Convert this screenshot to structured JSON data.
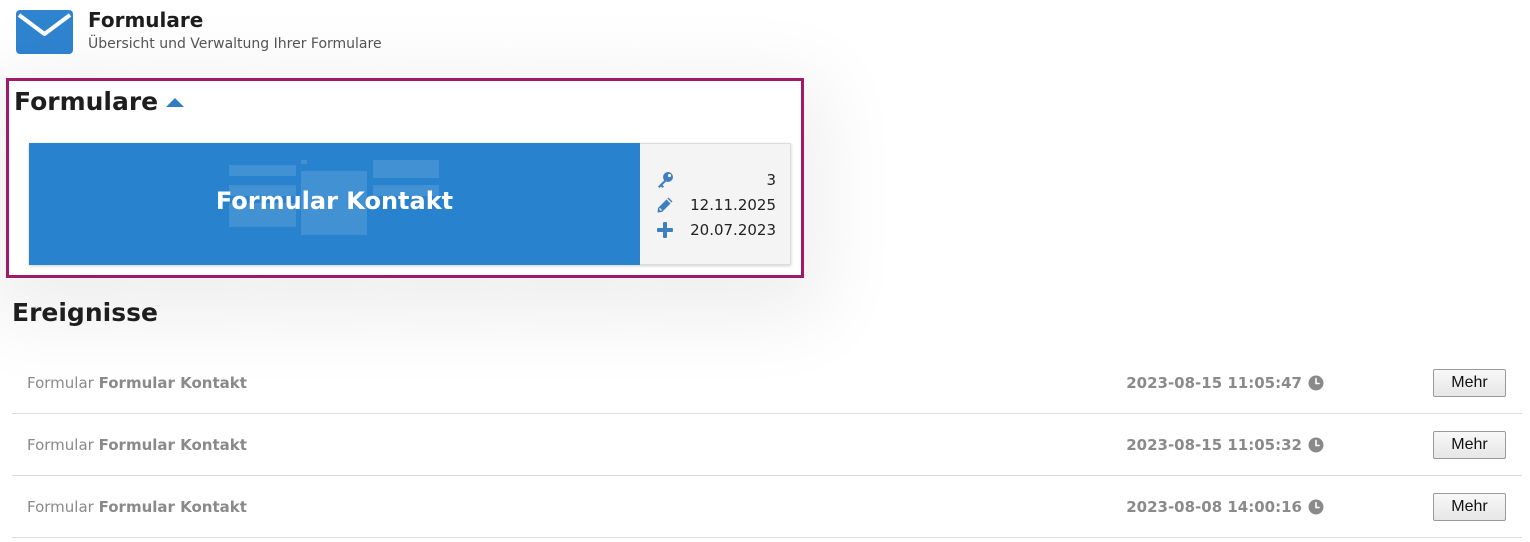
{
  "header": {
    "title": "Formulare",
    "subtitle": "Übersicht und Verwaltung Ihrer Formulare",
    "icon": "envelope-icon"
  },
  "forms_section": {
    "heading": "Formulare",
    "toggle_icon": "caret-up-icon",
    "highlight_color": "#a0196b",
    "cards": [
      {
        "title": "Formular Kontakt",
        "background_color": "#2882cd",
        "meta": [
          {
            "icon": "key-icon",
            "value": "3"
          },
          {
            "icon": "pencil-icon",
            "value": "12.11.2025"
          },
          {
            "icon": "plus-icon",
            "value": "20.07.2023"
          }
        ]
      }
    ]
  },
  "events_section": {
    "heading": "Ereignisse",
    "items": [
      {
        "type": "Formular",
        "name": "Formular Kontakt",
        "timestamp": "2023-08-15 11:05:47",
        "button": "Mehr"
      },
      {
        "type": "Formular",
        "name": "Formular Kontakt",
        "timestamp": "2023-08-15 11:05:32",
        "button": "Mehr"
      },
      {
        "type": "Formular",
        "name": "Formular Kontakt",
        "timestamp": "2023-08-08 14:00:16",
        "button": "Mehr"
      }
    ]
  },
  "colors": {
    "accent": "#2f7cc5",
    "muted_text": "#8a8a8a"
  }
}
